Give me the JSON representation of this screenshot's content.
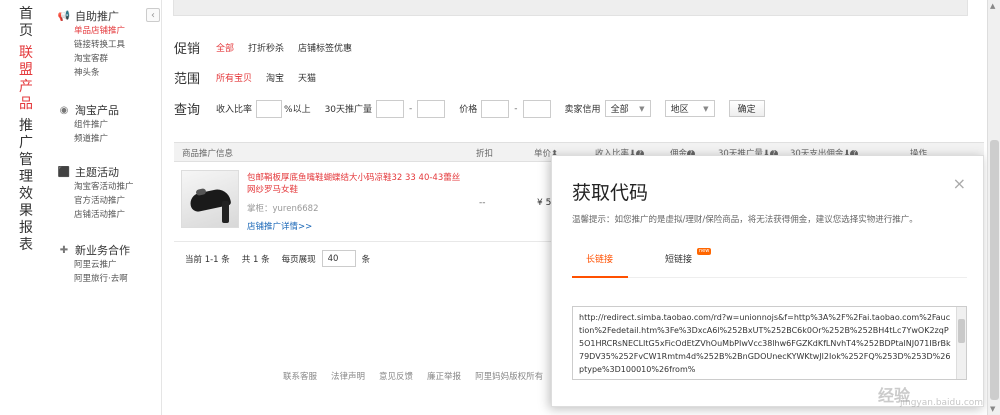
{
  "leftnav": {
    "home": "首页",
    "league": "联盟产品",
    "promo": "推广管理",
    "report": "效果报表"
  },
  "sidebar": {
    "collapse": "‹",
    "groups": [
      {
        "title": "自助推广",
        "icon": "megaphone-icon",
        "items": [
          "单品店铺推广",
          "链接转换工具",
          "淘宝客群",
          "神头条"
        ]
      },
      {
        "title": "淘宝产品",
        "icon": "taobao-icon",
        "items": [
          "组件推广",
          "频道推广"
        ]
      },
      {
        "title": "主题活动",
        "icon": "event-icon",
        "items": [
          "淘宝客活动推广",
          "官方活动推广",
          "店铺活动推广"
        ]
      },
      {
        "title": "新业务合作",
        "icon": "puzzle-icon",
        "items": [
          "阿里云推广",
          "阿里旅行·去啊"
        ]
      }
    ]
  },
  "filters": {
    "promo_label": "促销",
    "promo_opts": [
      "全部",
      "打折秒杀",
      "店铺标签优惠"
    ],
    "range_label": "范围",
    "range_opts": [
      "所有宝贝",
      "淘宝",
      "天猫"
    ],
    "query_label": "查询",
    "income_ratio": "收入比率",
    "income_suffix": "%以上",
    "sales_30": "30天推广量",
    "dash": "-",
    "price": "价格",
    "seller_credit": "卖家信用",
    "credit_value": "全部",
    "region": "地区",
    "confirm": "确定"
  },
  "table": {
    "headers": {
      "product": "商品推广信息",
      "discount": "折扣",
      "price": "单价",
      "income_ratio": "收入比率",
      "commission": "佣金",
      "sales30": "30天推广量",
      "spend30": "30天支出佣金",
      "action": "操作"
    },
    "row": {
      "title": "包邮鞘板厚底鱼嘴鞋蝴蝶结大小码凉鞋32 33 40-43蕾丝网纱罗马女鞋",
      "seller": "掌柜：yuren6682",
      "link": "店铺推广详情>>",
      "discount": "--",
      "price": "¥ 5"
    }
  },
  "pager": {
    "current": "当前 1-1 条",
    "total": "共 1 条",
    "per_page": "每页展现",
    "per_page_value": "40",
    "unit": "条"
  },
  "footer": [
    "联系客服",
    "法律声明",
    "意见反馈",
    "廉正举报",
    "阿里妈妈版权所有"
  ],
  "modal": {
    "title": "获取代码",
    "close": "×",
    "tip": "温馨提示：如您推广的是虚拟/理财/保险商品，将无法获得佣金，建议您选择实物进行推广。",
    "tab_long": "长链接",
    "tab_short": "短链接",
    "new_badge": "new",
    "code": "http://redirect.simba.taobao.com/rd?w=unionnojs&f=http%3A%2F%2Fai.taobao.com%2Fauction%2Fedetail.htm%3Fe%3DxcA6l%252BxUT%252BC6k0Or%252B%252BH4tLc7YwOK2zqP5O1HRCRsNECLItG5xFicOdEtZVhOuMbPIwVcc38lhw6FGZKdKfLNvhT4%252BDPtalNJ071IBrBk79DV35%252FvCW1Rmtm4d%252B%2BnGDOUnecKYWKtwJl2Iok%252FQ%253D%253D%26ptype%3D100010%26from%"
  },
  "watermark": "经验",
  "watermark_sub": "jingyan.baidu.com"
}
